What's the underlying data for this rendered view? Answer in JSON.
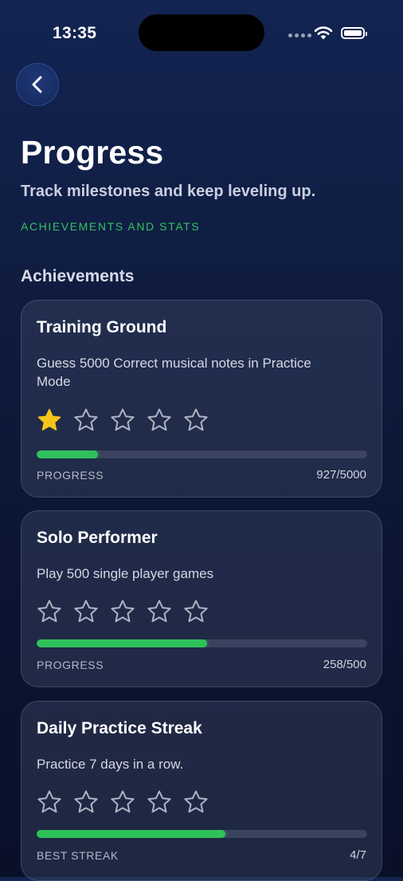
{
  "status": {
    "time": "13:35"
  },
  "header": {
    "title": "Progress",
    "subtitle": "Track milestones and keep leveling up.",
    "tag": "ACHIEVEMENTS AND STATS"
  },
  "section": {
    "title": "Achievements"
  },
  "colors": {
    "accent_green": "#2fc25b",
    "star_gold": "#f5c518",
    "star_outline": "#aeb4c4"
  },
  "achievements": [
    {
      "title": "Training Ground",
      "description": "Guess 5000 Correct musical notes in Practice Mode",
      "stars_filled": 1,
      "stars_total": 5,
      "progress_label": "PROGRESS",
      "progress_value": "927/5000",
      "progress_fraction": 0.185
    },
    {
      "title": "Solo Performer",
      "description": "Play 500 single player games",
      "stars_filled": 0,
      "stars_total": 5,
      "progress_label": "PROGRESS",
      "progress_value": "258/500",
      "progress_fraction": 0.516
    },
    {
      "title": "Daily Practice Streak",
      "description": "Practice 7 days in a row.",
      "stars_filled": 0,
      "stars_total": 5,
      "progress_label": "BEST STREAK",
      "progress_value": "4/7",
      "progress_fraction": 0.571
    }
  ]
}
